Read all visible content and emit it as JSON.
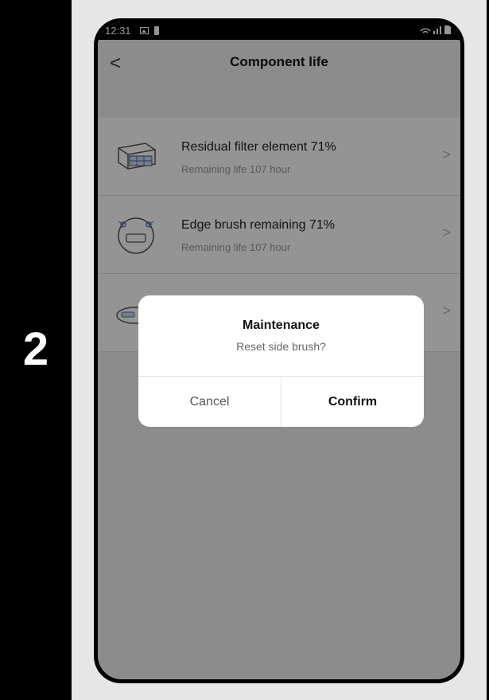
{
  "step": {
    "number": "2"
  },
  "status_bar": {
    "time": "12:31"
  },
  "header": {
    "back_label": "<",
    "title": "Component life"
  },
  "components": [
    {
      "title": "Residual filter element 71%",
      "subtitle": "Remaining life 107 hour",
      "icon": "filter-icon"
    },
    {
      "title": "Edge brush remaining 71%",
      "subtitle": "Remaining life 107 hour",
      "icon": "edge-brush-icon"
    },
    {
      "title": "",
      "subtitle": "",
      "icon": "main-brush-icon"
    }
  ],
  "chevron": ">",
  "dialog": {
    "title": "Maintenance",
    "message": "Reset side brush?",
    "cancel_label": "Cancel",
    "confirm_label": "Confirm"
  }
}
